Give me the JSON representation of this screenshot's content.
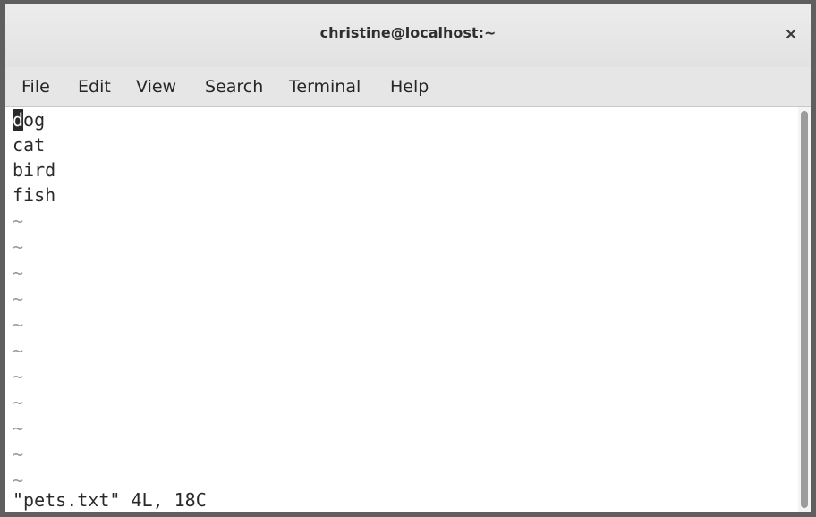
{
  "window": {
    "title": "christine@localhost:~"
  },
  "menu": {
    "items": [
      "File",
      "Edit",
      "View",
      "Search",
      "Terminal",
      "Help"
    ]
  },
  "buffer": {
    "cursor_char": "d",
    "lines": [
      "dog",
      "cat",
      "bird",
      "fish"
    ],
    "first_line_rest": "og",
    "empty_marker": "~",
    "status": "\"pets.txt\" 4L, 18C"
  },
  "icons": {
    "close": "close-icon"
  }
}
